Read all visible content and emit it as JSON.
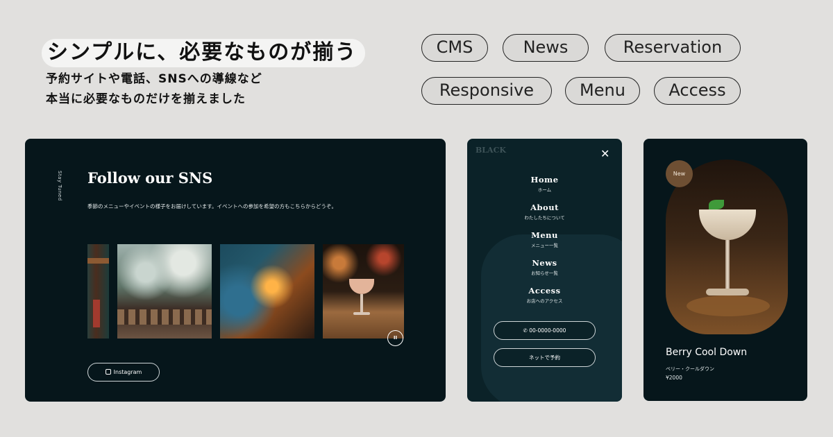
{
  "header": {
    "headline": "シンプルに、必要なものが揃う",
    "subcopy_line1": "予約サイトや電話、SNSへの導線など",
    "subcopy_line2": "本当に必要なものだけを揃えました"
  },
  "tags": [
    "CMS",
    "News",
    "Reservation",
    "Responsive",
    "Menu",
    "Access"
  ],
  "sns": {
    "vertical_label": "Stay Tuned",
    "title": "Follow our SNS",
    "description": "季節のメニューやイベントの様子をお届けしています。イベントへの参加を希望の方もこちらからどうぞ。",
    "pause_icon": "pause-icon",
    "instagram_label": "Instagram"
  },
  "menu": {
    "logo": "BLACK",
    "close_icon": "close-icon",
    "items": [
      {
        "en": "Home",
        "jp": "ホーム"
      },
      {
        "en": "About",
        "jp": "わたしたちについて"
      },
      {
        "en": "Menu",
        "jp": "メニュー一覧"
      },
      {
        "en": "News",
        "jp": "お知らせ一覧"
      },
      {
        "en": "Access",
        "jp": "お店へのアクセス"
      }
    ],
    "phone_label": "00-0000-0000",
    "reserve_label": "ネットで予約"
  },
  "product": {
    "badge": "New",
    "name": "Berry Cool Down",
    "kana": "ベリー・クールダウン",
    "price": "¥2000"
  },
  "colors": {
    "background": "#e1e0de",
    "panel": "#06161b",
    "badge": "#6e4f33"
  }
}
